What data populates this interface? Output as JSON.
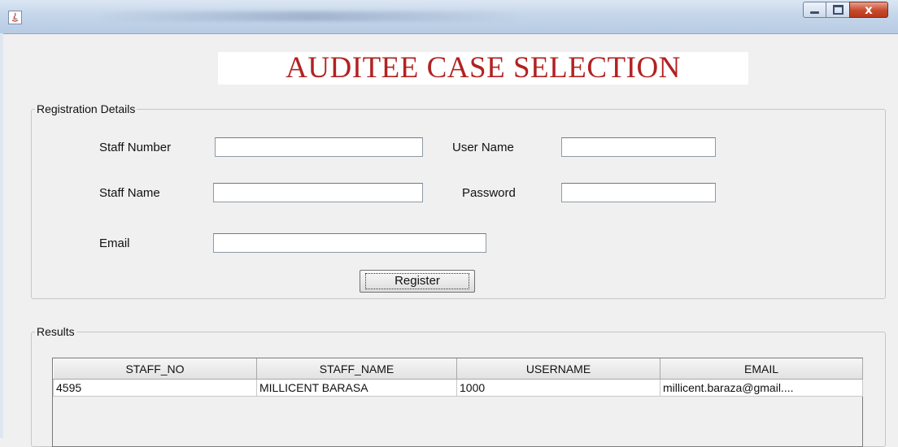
{
  "window": {
    "title": "",
    "close_glyph": "x"
  },
  "page": {
    "title": "AUDITEE CASE SELECTION",
    "title_color": "#b22222"
  },
  "registration": {
    "legend": "Registration Details",
    "staff_number": {
      "label": "Staff Number",
      "value": ""
    },
    "staff_name": {
      "label": "Staff Name",
      "value": ""
    },
    "email": {
      "label": "Email",
      "value": ""
    },
    "user_name": {
      "label": "User Name",
      "value": ""
    },
    "password": {
      "label": "Password",
      "value": ""
    },
    "register_label": "Register"
  },
  "results": {
    "legend": "Results",
    "columns": [
      "STAFF_NO",
      "STAFF_NAME",
      "USERNAME",
      "EMAIL"
    ],
    "rows": [
      [
        "4595",
        "MILLICENT BARASA",
        "1000",
        "millicent.baraza@gmail...."
      ]
    ]
  }
}
